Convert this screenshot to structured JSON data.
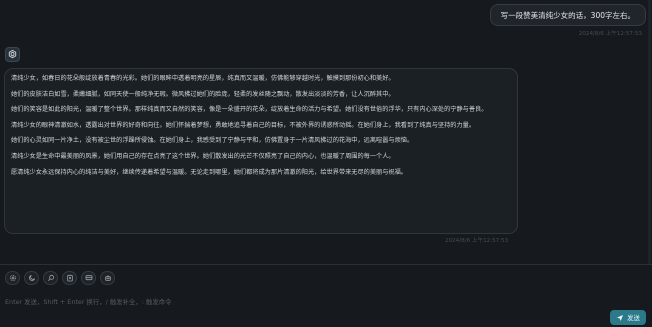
{
  "user_message": {
    "text": "写一段赞美清纯少女的话，300字左右。",
    "time": "2024/8/6 上午12:57:53"
  },
  "bot_message": {
    "avatar_icon": "openai-logo-icon",
    "paragraphs": [
      "清纯少女，如春日的花朵般绽放着青春的光彩。她们的眼眸中透着明亮的星辰，纯真而又温暖，仿佛能够穿越时光，触摸到那份初心和美好。",
      "她们的皮肤洁白如雪，柔嫩细腻，如同天使一般纯净无瑕。微风拂过她们的脸庞，轻柔的发丝随之飘动，散发出淡淡的芳香，让人沉醉其中。",
      "她们的笑容是如此的阳光，温暖了整个世界。那样纯真而又自然的笑容，像是一朵盛开的花朵，绽放着生命的活力与希望。她们没有世俗的浮华，只有内心深处的宁静与善良。",
      "清纯少女的眼神清澈如水，透露出对世界的好奇和向往。她们怀揣着梦想，勇敢地追寻着自己的目标，不被外界的诱惑所动摇。在她们身上，我看到了纯真与坚持的力量。",
      "她们的心灵如同一片净土，没有被尘世的浮躁所侵蚀。在她们身上，我感受到了宁静与平和，仿佛置身于一片清风拂过的花海中，远离喧嚣与烦恼。",
      "清纯少女是生命中最美丽的风景，她们用自己的存在点亮了这个世界。她们散发出的光芒不仅照亮了自己的内心，也温暖了周围的每一个人。",
      "愿清纯少女永远保持内心的纯洁与美好，继续传递着希望与温暖。无论走到哪里，她们都将成为那片清澈的阳光，给世界带来无尽的美丽与祝福。"
    ],
    "time": "2024/8/6 上午12:57:53"
  },
  "toolbar": {
    "buttons": [
      "settings-icon",
      "theme-icon",
      "search-icon",
      "clipboard-icon",
      "chat-icon",
      "robot-icon"
    ]
  },
  "composer": {
    "placeholder": "Enter 发送，Shift + Enter 换行，/ 触发补全，: 触发命令",
    "send_label": "发送"
  },
  "colors": {
    "background": "#161a1e",
    "bubble": "#1b2025",
    "accent": "#2b7a8a"
  }
}
